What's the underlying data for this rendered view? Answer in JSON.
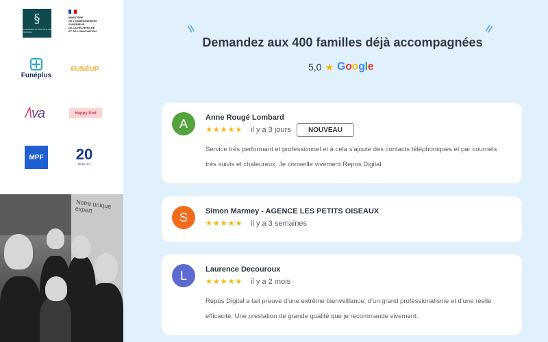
{
  "partners": {
    "chambre_france": {
      "glyph": "§",
      "text": "CHAMBRE SYNDICALE DE FRANCE"
    },
    "ministere": {
      "text": "MINISTÈRE\nDE L'ENSEIGNEMENT\nSUPÉRIEUR,\nDE LA RECHERCHE\nET DE L'INNOVATION",
      "flag_colors": [
        "#1f3f95",
        "#ffffff",
        "#e1000f"
      ]
    },
    "funeplus": {
      "text": "Funéplus"
    },
    "funeup": {
      "text": "FUNÉUP"
    },
    "ava": {
      "text": "va"
    },
    "happy_end": {
      "text": "Happy End"
    },
    "mpf": {
      "text": "MPF"
    },
    "vingt": {
      "text": "20",
      "sub": "MINUTES"
    }
  },
  "photo": {
    "wall_text": "Notre unique expert"
  },
  "header": {
    "headline": "Demandez aux 400 familles déjà accompagnées",
    "rating": "5,0",
    "star": "★",
    "google_letters": [
      {
        "char": "G",
        "color": "#4285F4"
      },
      {
        "char": "o",
        "color": "#EA4335"
      },
      {
        "char": "o",
        "color": "#FBBC05"
      },
      {
        "char": "g",
        "color": "#4285F4"
      },
      {
        "char": "l",
        "color": "#34A853"
      },
      {
        "char": "e",
        "color": "#EA4335"
      }
    ],
    "accent_color": "#5aa6e6"
  },
  "reviews": [
    {
      "initial": "A",
      "avatar_color": "#55a33c",
      "name": "Anne Rougé Lombard",
      "stars": "★★★★★",
      "time": "il y a 3 jours",
      "badge": "NOUVEAU",
      "text": "Service très performant et professionnel et à cela s'ajoute des contacts téléphoniques et par courriels très suivis et chaleureux. Je conseille vivement Repos Digital."
    },
    {
      "initial": "S",
      "avatar_color": "#f26b1d",
      "name": "Simon Marmey - AGENCE LES PETITS OISEAUX",
      "stars": "★★★★★",
      "time": "il y a 3 semaines",
      "badge": "",
      "text": ""
    },
    {
      "initial": "L",
      "avatar_color": "#5b6bd1",
      "name": "Laurence Decouroux",
      "stars": "★★★★★",
      "time": "il y a 2 mois",
      "badge": "",
      "text": "Repos Digital a fait preuve d'une extrême bienveillance, d'un grand professionalisme et d'une réelle efficacité. Une prestation de grande qualité que je recommande vivement."
    }
  ]
}
